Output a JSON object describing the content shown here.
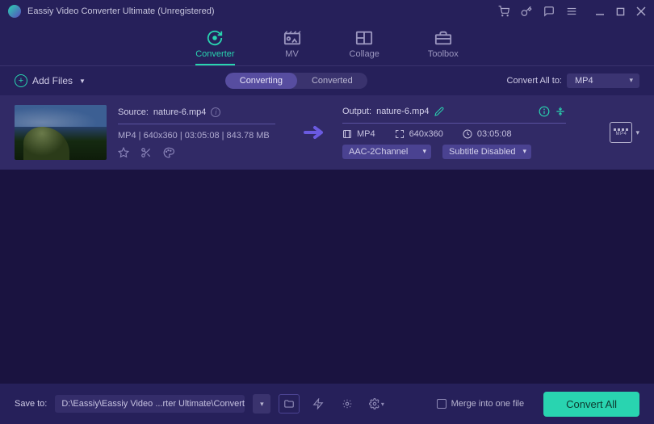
{
  "window": {
    "title": "Eassiy Video Converter Ultimate (Unregistered)"
  },
  "tabs": {
    "converter": "Converter",
    "mv": "MV",
    "collage": "Collage",
    "toolbox": "Toolbox"
  },
  "subbar": {
    "add_files": "Add Files",
    "converting": "Converting",
    "converted": "Converted",
    "convert_all_to": "Convert All to:",
    "format_selected": "MP4"
  },
  "file": {
    "source_label": "Source:",
    "source_name": "nature-6.mp4",
    "meta": "MP4 | 640x360 | 03:05:08 | 843.78 MB",
    "output_label": "Output:",
    "output_name": "nature-6.mp4",
    "fmt": "MP4",
    "res": "640x360",
    "dur": "03:05:08",
    "audio": "AAC-2Channel",
    "subtitle": "Subtitle Disabled",
    "fmtbox_text": "MP4"
  },
  "footer": {
    "save_to": "Save to:",
    "path": "D:\\Eassiy\\Eassiy Video ...rter Ultimate\\Converted",
    "merge": "Merge into one file",
    "convert_all": "Convert All"
  }
}
